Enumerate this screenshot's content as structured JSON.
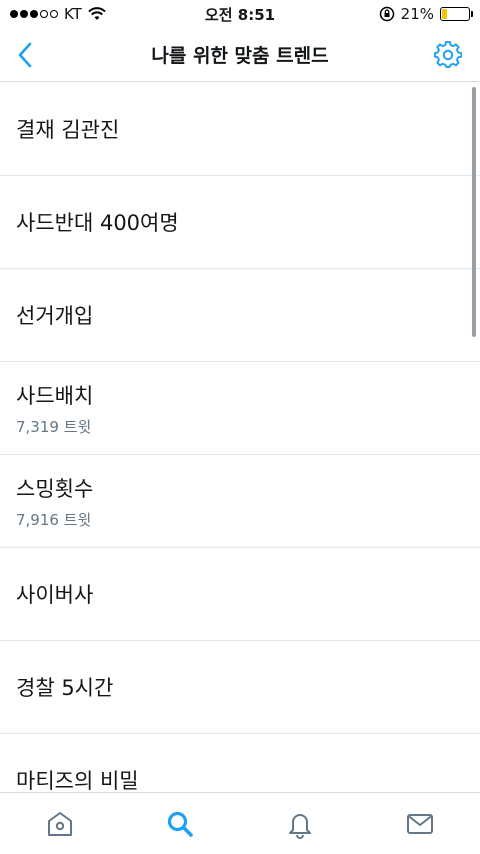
{
  "status_bar": {
    "carrier": "KT",
    "time": "오전 8:51",
    "battery_percent_text": "21%",
    "battery_level": 0.21
  },
  "header": {
    "title": "나를 위한 맞춤 트렌드"
  },
  "trends": [
    {
      "title": "결재 김관진",
      "tweets": ""
    },
    {
      "title": "사드반대 400여명",
      "tweets": ""
    },
    {
      "title": "선거개입",
      "tweets": ""
    },
    {
      "title": "사드배치",
      "tweets": "7,319 트윗"
    },
    {
      "title": "스밍횟수",
      "tweets": "7,916 트윗"
    },
    {
      "title": "사이버사",
      "tweets": ""
    },
    {
      "title": "경찰 5시간",
      "tweets": ""
    },
    {
      "title": "마티즈의 비밀",
      "tweets": ""
    }
  ],
  "tabs": [
    {
      "icon": "home-icon",
      "active": false
    },
    {
      "icon": "search-icon",
      "active": true
    },
    {
      "icon": "bell-icon",
      "active": false
    },
    {
      "icon": "mail-icon",
      "active": false
    }
  ],
  "colors": {
    "accent": "#1da1f2",
    "inactive_icon": "#657786",
    "battery": "#f5c400"
  }
}
